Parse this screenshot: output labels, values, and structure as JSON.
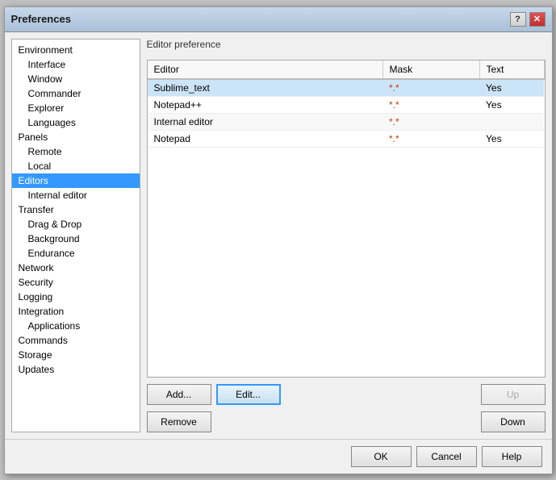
{
  "window": {
    "title": "Preferences",
    "help_label": "?",
    "close_label": "✕"
  },
  "sidebar": {
    "items": [
      {
        "id": "environment",
        "label": "Environment",
        "level": "section",
        "selected": false
      },
      {
        "id": "interface",
        "label": "Interface",
        "level": "sub",
        "selected": false
      },
      {
        "id": "window",
        "label": "Window",
        "level": "sub",
        "selected": false
      },
      {
        "id": "commander",
        "label": "Commander",
        "level": "sub",
        "selected": false
      },
      {
        "id": "explorer",
        "label": "Explorer",
        "level": "sub",
        "selected": false
      },
      {
        "id": "languages",
        "label": "Languages",
        "level": "sub",
        "selected": false
      },
      {
        "id": "panels",
        "label": "Panels",
        "level": "section",
        "selected": false
      },
      {
        "id": "remote",
        "label": "Remote",
        "level": "sub",
        "selected": false
      },
      {
        "id": "local",
        "label": "Local",
        "level": "sub",
        "selected": false
      },
      {
        "id": "editors",
        "label": "Editors",
        "level": "section",
        "selected": true
      },
      {
        "id": "internal-editor",
        "label": "Internal editor",
        "level": "sub",
        "selected": false
      },
      {
        "id": "transfer",
        "label": "Transfer",
        "level": "section",
        "selected": false
      },
      {
        "id": "drag-drop",
        "label": "Drag & Drop",
        "level": "sub",
        "selected": false
      },
      {
        "id": "background",
        "label": "Background",
        "level": "sub",
        "selected": false
      },
      {
        "id": "endurance",
        "label": "Endurance",
        "level": "sub",
        "selected": false
      },
      {
        "id": "network",
        "label": "Network",
        "level": "section",
        "selected": false
      },
      {
        "id": "security",
        "label": "Security",
        "level": "section",
        "selected": false
      },
      {
        "id": "logging",
        "label": "Logging",
        "level": "section",
        "selected": false
      },
      {
        "id": "integration",
        "label": "Integration",
        "level": "section",
        "selected": false
      },
      {
        "id": "applications",
        "label": "Applications",
        "level": "sub",
        "selected": false
      },
      {
        "id": "commands",
        "label": "Commands",
        "level": "section",
        "selected": false
      },
      {
        "id": "storage",
        "label": "Storage",
        "level": "section",
        "selected": false
      },
      {
        "id": "updates",
        "label": "Updates",
        "level": "section",
        "selected": false
      }
    ]
  },
  "main": {
    "section_title": "Editor preference",
    "table": {
      "columns": [
        "Editor",
        "Mask",
        "Text"
      ],
      "rows": [
        {
          "editor": "Sublime_text",
          "mask": "*.*",
          "text": "Yes",
          "selected": true
        },
        {
          "editor": "Notepad++",
          "mask": "*.*",
          "text": "Yes",
          "selected": false
        },
        {
          "editor": "Internal editor",
          "mask": "*.*",
          "text": "",
          "selected": false
        },
        {
          "editor": "Notepad",
          "mask": "*.*",
          "text": "Yes",
          "selected": false
        }
      ]
    }
  },
  "buttons": {
    "add": "Add...",
    "edit": "Edit...",
    "remove": "Remove",
    "up": "Up",
    "down": "Down"
  },
  "footer": {
    "ok": "OK",
    "cancel": "Cancel",
    "help": "Help"
  }
}
